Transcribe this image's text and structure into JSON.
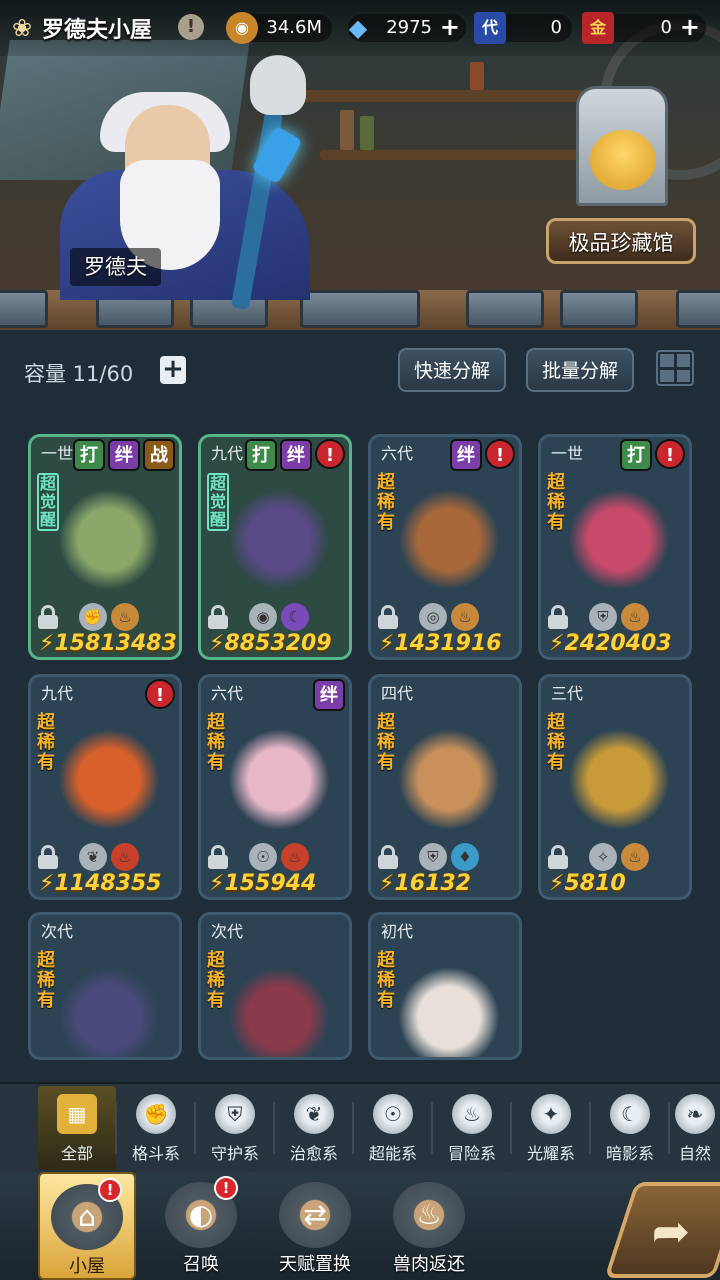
{
  "header": {
    "title": "罗德夫小屋",
    "info_icon": "!",
    "resources": [
      {
        "name": "coin",
        "icon": "coin-icon",
        "value": "34.6M",
        "has_plus": false
      },
      {
        "name": "crystal",
        "icon": "crystal-icon",
        "value": "2975",
        "has_plus": true
      },
      {
        "name": "ticket",
        "icon": "ticket-icon",
        "glyph": "代",
        "value": "0",
        "has_plus": false
      },
      {
        "name": "gold-ticket",
        "icon": "gold-ticket-icon",
        "glyph": "金",
        "value": "0",
        "has_plus": true
      }
    ],
    "plus": "+"
  },
  "scene": {
    "npc_name": "罗德夫",
    "gallery_button": "极品珍藏馆"
  },
  "storage": {
    "capacity_label": "容量 11/60",
    "add": "+",
    "quick_decompose": "快速分解",
    "batch_decompose": "批量分解"
  },
  "cards": [
    {
      "gen": "一世",
      "status": "超觉醒",
      "tags": [
        "打",
        "绊",
        "战"
      ],
      "power": "15813483",
      "badges": [
        "fist-icon",
        "meat-icon"
      ],
      "color": "#8ba86a",
      "highlight": true
    },
    {
      "gen": "九代",
      "status": "超觉醒",
      "tags": [
        "打",
        "绊",
        "!"
      ],
      "power": "8853209",
      "badges": [
        "eye-icon",
        "moon-icon"
      ],
      "color": "#5a4a88",
      "highlight": true
    },
    {
      "gen": "六代",
      "status": "超稀有",
      "tags": [
        "绊",
        "!"
      ],
      "power": "1431916",
      "badges": [
        "target-icon",
        "meat-icon"
      ],
      "color": "#a8683a",
      "highlight": false
    },
    {
      "gen": "一世",
      "status": "超稀有",
      "tags": [
        "打",
        "!"
      ],
      "power": "2420403",
      "badges": [
        "shield-icon",
        "meat-icon"
      ],
      "color": "#c84a6a",
      "highlight": false
    },
    {
      "gen": "九代",
      "status": "超稀有",
      "tags": [
        "!"
      ],
      "power": "1148355",
      "badges": [
        "leaf-icon",
        "fire-icon"
      ],
      "color": "#d8602a",
      "highlight": false
    },
    {
      "gen": "六代",
      "status": "超稀有",
      "tags": [
        "绊"
      ],
      "power": "155944",
      "badges": [
        "alien-icon",
        "fire-icon"
      ],
      "color": "#e8b8c8",
      "highlight": false
    },
    {
      "gen": "四代",
      "status": "超稀有",
      "tags": [],
      "power": "16132",
      "badges": [
        "shield-icon",
        "water-icon"
      ],
      "color": "#c8905a",
      "highlight": false
    },
    {
      "gen": "三代",
      "status": "超稀有",
      "tags": [],
      "power": "5810",
      "badges": [
        "crystal-icon",
        "meat-icon"
      ],
      "color": "#c89a3a",
      "highlight": false
    },
    {
      "gen": "次代",
      "status": "超稀有",
      "tags": [],
      "power": "",
      "badges": [],
      "color": "#4a4a7a",
      "highlight": false
    },
    {
      "gen": "次代",
      "status": "超稀有",
      "tags": [],
      "power": "",
      "badges": [],
      "color": "#8a3a4a",
      "highlight": false
    },
    {
      "gen": "初代",
      "status": "超稀有",
      "tags": [],
      "power": "",
      "badges": [],
      "color": "#e8e0d8",
      "highlight": false
    }
  ],
  "filters": [
    {
      "label": "全部",
      "icon": "all-icon",
      "glyph": "▦"
    },
    {
      "label": "格斗系",
      "icon": "fist-icon",
      "glyph": "✊"
    },
    {
      "label": "守护系",
      "icon": "shield-icon",
      "glyph": "⛨"
    },
    {
      "label": "治愈系",
      "icon": "leaf-icon",
      "glyph": "❦"
    },
    {
      "label": "超能系",
      "icon": "alien-icon",
      "glyph": "☉"
    },
    {
      "label": "冒险系",
      "icon": "flame-icon",
      "glyph": "♨"
    },
    {
      "label": "光耀系",
      "icon": "star-icon",
      "glyph": "✦"
    },
    {
      "label": "暗影系",
      "icon": "moon-icon",
      "glyph": "☾"
    },
    {
      "label": "自然",
      "icon": "nature-icon",
      "glyph": "❧"
    }
  ],
  "nav": [
    {
      "label": "小屋",
      "icon": "house-icon",
      "glyph": "⌂",
      "alert": true
    },
    {
      "label": "召唤",
      "icon": "egg-icon",
      "glyph": "◐",
      "alert": true
    },
    {
      "label": "天赋置换",
      "icon": "swap-icon",
      "glyph": "⇄",
      "alert": false
    },
    {
      "label": "兽肉返还",
      "icon": "meat-icon",
      "glyph": "♨",
      "alert": false
    }
  ],
  "alert_glyph": "!",
  "return_glyph": "➦"
}
